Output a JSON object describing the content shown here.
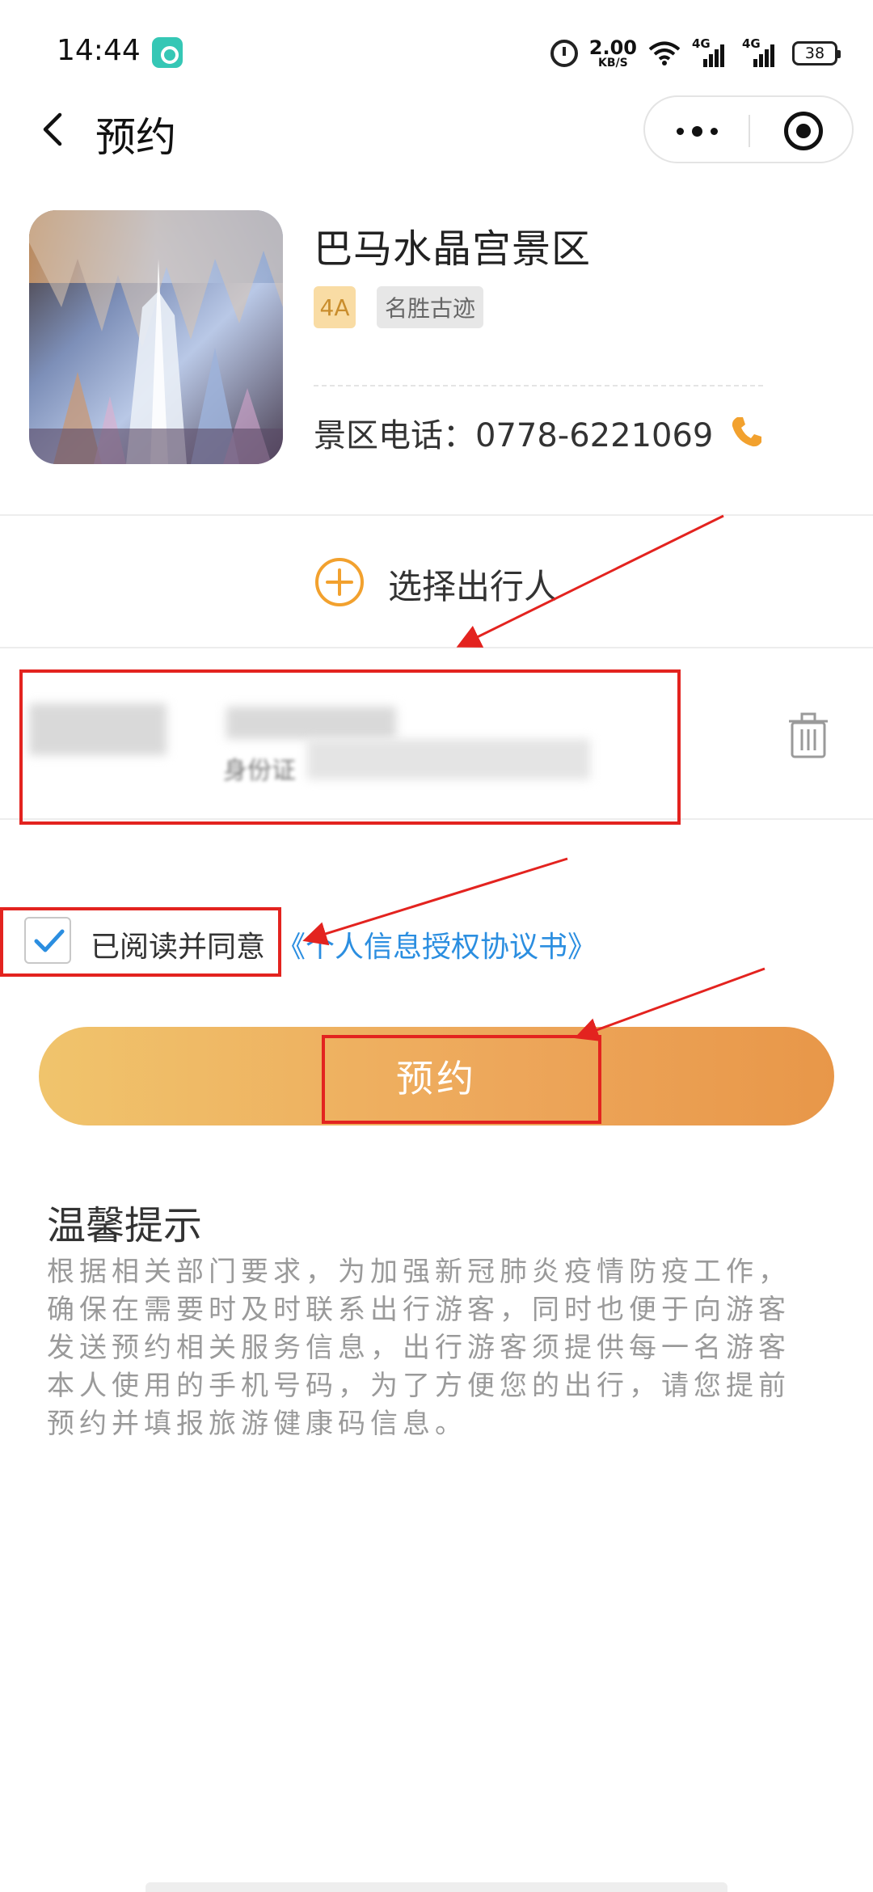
{
  "status_bar": {
    "time": "14:44",
    "net_speed_value": "2.00",
    "net_speed_unit": "KB/S",
    "sim1_label": "4G",
    "sim2_label": "4G",
    "battery": "38"
  },
  "nav": {
    "title": "预约"
  },
  "scenic": {
    "name": "巴马水晶宫景区",
    "level_tag": "4A",
    "type_tag": "名胜古迹",
    "phone_text": "景区电话：0778-6221069"
  },
  "traveler": {
    "select_label": "选择出行人",
    "id_label": "身份证"
  },
  "agreement": {
    "text": "已阅读并同意",
    "link": "《个人信息授权协议书》",
    "checked": true
  },
  "reserve": {
    "label": "预约"
  },
  "tips": {
    "title": "温馨提示",
    "body": "根据相关部门要求，为加强新冠肺炎疫情防疫工作，确保在需要时及时联系出行游客，同时也便于向游客发送预约相关服务信息，出行游客须提供每一名游客本人使用的手机号码，为了方便您的出行，请您提前预约并填报旅游健康码信息。"
  },
  "colors": {
    "accent_orange": "#eda65a",
    "link_blue": "#2b8ee0",
    "annotation_red": "#e3231f"
  }
}
